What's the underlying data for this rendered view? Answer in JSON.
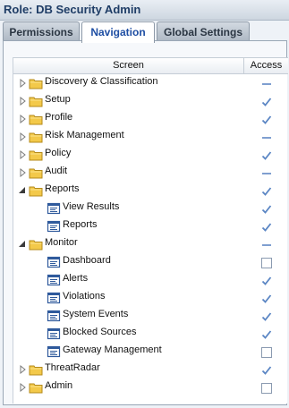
{
  "window": {
    "title": "Role: DB Security Admin"
  },
  "tabs": [
    {
      "label": "Permissions",
      "active": false
    },
    {
      "label": "Navigation",
      "active": true
    },
    {
      "label": "Global Settings",
      "active": false
    }
  ],
  "grid": {
    "columns": {
      "screen": "Screen",
      "access": "Access"
    },
    "rows": [
      {
        "label": "Discovery & Classification",
        "type": "folder",
        "level": 0,
        "expander": "collapsed",
        "access": "partial"
      },
      {
        "label": "Setup",
        "type": "folder",
        "level": 0,
        "expander": "collapsed",
        "access": "checked"
      },
      {
        "label": "Profile",
        "type": "folder",
        "level": 0,
        "expander": "collapsed",
        "access": "checked"
      },
      {
        "label": "Risk Management",
        "type": "folder",
        "level": 0,
        "expander": "collapsed",
        "access": "partial"
      },
      {
        "label": "Policy",
        "type": "folder",
        "level": 0,
        "expander": "collapsed",
        "access": "checked"
      },
      {
        "label": "Audit",
        "type": "folder",
        "level": 0,
        "expander": "collapsed",
        "access": "partial"
      },
      {
        "label": "Reports",
        "type": "folder",
        "level": 0,
        "expander": "expanded",
        "access": "checked"
      },
      {
        "label": "View Results",
        "type": "screen",
        "level": 1,
        "expander": "none",
        "access": "checked"
      },
      {
        "label": "Reports",
        "type": "screen",
        "level": 1,
        "expander": "none",
        "access": "checked"
      },
      {
        "label": "Monitor",
        "type": "folder",
        "level": 0,
        "expander": "expanded",
        "access": "partial"
      },
      {
        "label": "Dashboard",
        "type": "screen",
        "level": 1,
        "expander": "none",
        "access": "unchecked"
      },
      {
        "label": "Alerts",
        "type": "screen",
        "level": 1,
        "expander": "none",
        "access": "checked"
      },
      {
        "label": "Violations",
        "type": "screen",
        "level": 1,
        "expander": "none",
        "access": "checked"
      },
      {
        "label": "System Events",
        "type": "screen",
        "level": 1,
        "expander": "none",
        "access": "checked"
      },
      {
        "label": "Blocked Sources",
        "type": "screen",
        "level": 1,
        "expander": "none",
        "access": "checked"
      },
      {
        "label": "Gateway Management",
        "type": "screen",
        "level": 1,
        "expander": "none",
        "access": "unchecked"
      },
      {
        "label": "ThreatRadar",
        "type": "folder",
        "level": 0,
        "expander": "collapsed",
        "access": "checked"
      },
      {
        "label": "Admin",
        "type": "folder",
        "level": 0,
        "expander": "collapsed",
        "access": "unchecked"
      }
    ]
  },
  "colors": {
    "check": "#5b86c4",
    "partial": "#7f9fd0",
    "folder": "#f3c94a",
    "screen_icon": "#2f5a9c"
  }
}
